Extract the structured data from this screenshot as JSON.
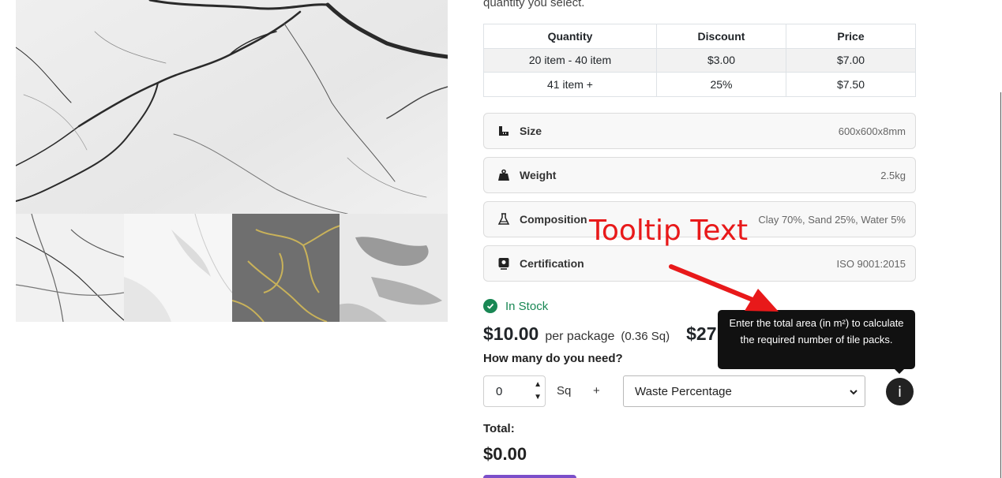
{
  "intro_text": "quantity you select.",
  "discount_table": {
    "headers": [
      "Quantity",
      "Discount",
      "Price"
    ],
    "rows": [
      [
        "20 item - 40 item",
        "$3.00",
        "$7.00"
      ],
      [
        "41 item +",
        "25%",
        "$7.50"
      ]
    ]
  },
  "specs": [
    {
      "label": "Size",
      "value": "600x600x8mm",
      "icon": "ruler-icon"
    },
    {
      "label": "Weight",
      "value": "2.5kg",
      "icon": "weight-icon"
    },
    {
      "label": "Composition",
      "value": "Clay 70%, Sand 25%, Water 5%",
      "icon": "flask-icon"
    },
    {
      "label": "Certification",
      "value": "ISO 9001:2015",
      "icon": "certificate-icon"
    }
  ],
  "stock_status": "In Stock",
  "price": {
    "main": "$10.00",
    "unit": "per package",
    "sq": "(0.36 Sq)",
    "alt": "$27."
  },
  "need_label": "How many do you need?",
  "quantity": {
    "value": "0",
    "unit": "Sq",
    "plus": "+"
  },
  "waste_select": {
    "selected": "Waste Percentage"
  },
  "info_button": "i",
  "tooltip": "Enter the total area (in m²) to calculate the required number of tile packs.",
  "total": {
    "label": "Total:",
    "value": "$0.00"
  },
  "annotation": "Tooltip Text",
  "colors": {
    "in_stock": "#198754",
    "annotation": "#e8191a",
    "tooltip_bg": "#111111",
    "cart_button": "#7b4fc9"
  }
}
